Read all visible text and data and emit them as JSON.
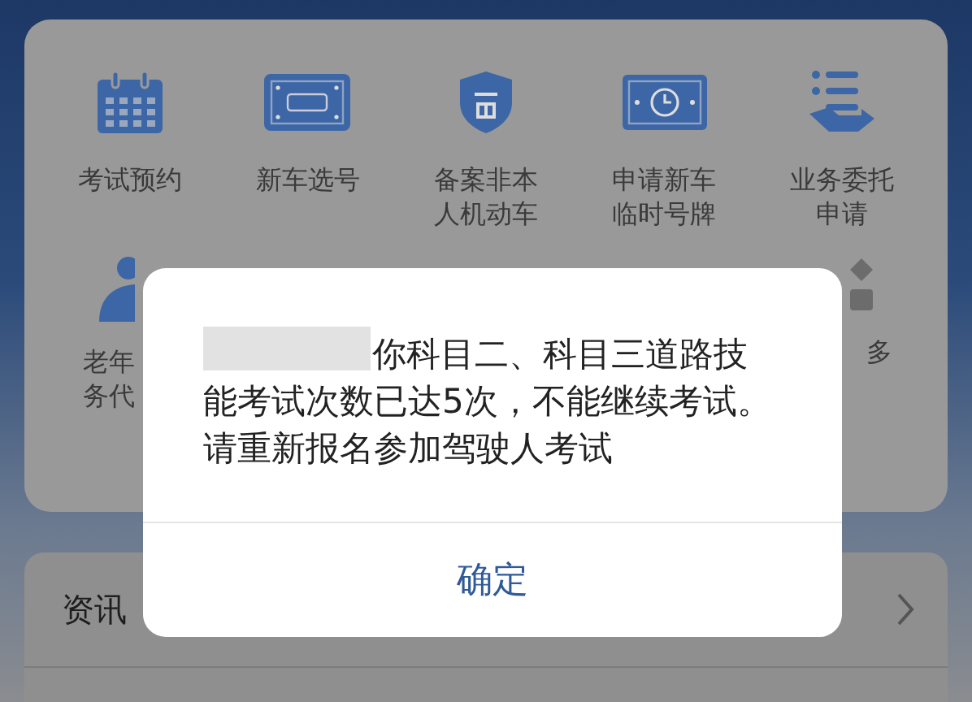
{
  "services": [
    {
      "lines": [
        "考试预约"
      ]
    },
    {
      "lines": [
        "新车选号"
      ]
    },
    {
      "lines": [
        "备案非本",
        "人机动车"
      ]
    },
    {
      "lines": [
        "申请新车",
        "临时号牌"
      ]
    },
    {
      "lines": [
        "业务委托",
        "申请"
      ]
    }
  ],
  "services_row2": [
    {
      "lines": [
        "老年",
        "务代"
      ]
    },
    {
      "lines": [
        "多"
      ]
    }
  ],
  "news": {
    "title": "资讯"
  },
  "dialog": {
    "message": "你科目二、科目三道路技能考试次数已达5次，不能继续考试。请重新报名参加驾驶人考试",
    "redacted": true,
    "button": "确定"
  }
}
